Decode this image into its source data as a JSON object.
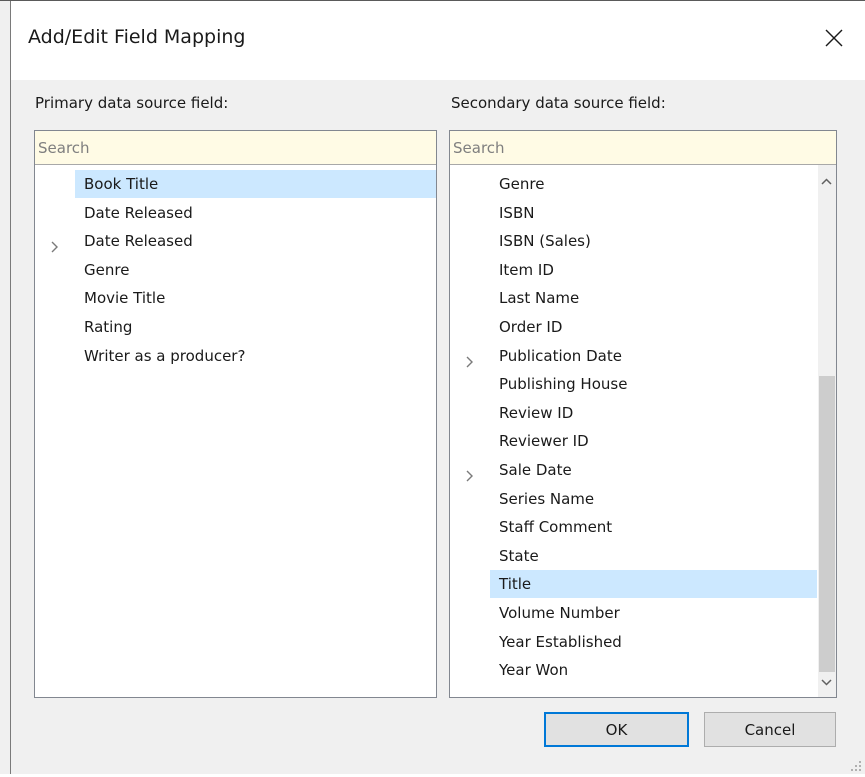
{
  "dialog": {
    "title": "Add/Edit Field Mapping",
    "close_icon": "close-icon"
  },
  "primary": {
    "label": "Primary data source field:",
    "search_placeholder": "Search",
    "items": [
      {
        "label": "Book Title",
        "selected": true,
        "expandable": false
      },
      {
        "label": "Date Released",
        "selected": false,
        "expandable": false
      },
      {
        "label": "Date Released",
        "selected": false,
        "expandable": true
      },
      {
        "label": "Genre",
        "selected": false,
        "expandable": false
      },
      {
        "label": "Movie Title",
        "selected": false,
        "expandable": false
      },
      {
        "label": "Rating",
        "selected": false,
        "expandable": false
      },
      {
        "label": "Writer as a producer?",
        "selected": false,
        "expandable": false
      }
    ]
  },
  "secondary": {
    "label": "Secondary data source field:",
    "search_placeholder": "Search",
    "items": [
      {
        "label": "Genre",
        "selected": false,
        "expandable": false
      },
      {
        "label": "ISBN",
        "selected": false,
        "expandable": false
      },
      {
        "label": "ISBN (Sales)",
        "selected": false,
        "expandable": false
      },
      {
        "label": "Item ID",
        "selected": false,
        "expandable": false
      },
      {
        "label": "Last Name",
        "selected": false,
        "expandable": false
      },
      {
        "label": "Order ID",
        "selected": false,
        "expandable": false
      },
      {
        "label": "Publication Date",
        "selected": false,
        "expandable": true
      },
      {
        "label": "Publishing House",
        "selected": false,
        "expandable": false
      },
      {
        "label": "Review ID",
        "selected": false,
        "expandable": false
      },
      {
        "label": "Reviewer ID",
        "selected": false,
        "expandable": false
      },
      {
        "label": "Sale Date",
        "selected": false,
        "expandable": true
      },
      {
        "label": "Series Name",
        "selected": false,
        "expandable": false
      },
      {
        "label": "Staff Comment",
        "selected": false,
        "expandable": false
      },
      {
        "label": "State",
        "selected": false,
        "expandable": false
      },
      {
        "label": "Title",
        "selected": true,
        "expandable": false
      },
      {
        "label": "Volume Number",
        "selected": false,
        "expandable": false
      },
      {
        "label": "Year Established",
        "selected": false,
        "expandable": false
      },
      {
        "label": "Year Won",
        "selected": false,
        "expandable": false
      }
    ],
    "scroll_position": 1.0
  },
  "buttons": {
    "ok_label": "OK",
    "cancel_label": "Cancel"
  },
  "colors": {
    "selection": "#cce8ff",
    "search_background": "#fffbe5",
    "default_button_border": "#0078d7"
  }
}
